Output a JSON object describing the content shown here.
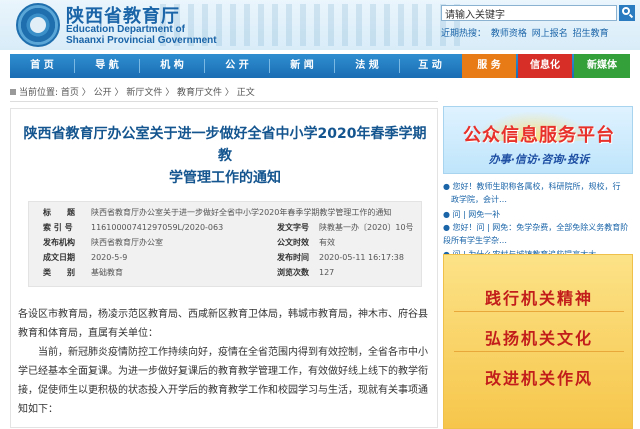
{
  "header": {
    "site_name": "陕西省教育厅",
    "site_en_line1": "Education Department of",
    "site_en_line2": "Shaanxi Provincial Government",
    "search": {
      "placeholder": "请输入关键字",
      "value": "请输入关键字"
    },
    "hot_search": [
      "近期热搜：",
      "教师资格",
      "网上报名",
      "招生教育"
    ],
    "search_icon": "search-icon",
    "emblem_icon": "emblem-logo"
  },
  "nav": {
    "items": [
      "首 页",
      "导 航",
      "机 构",
      "公 开",
      "新 闻",
      "法 规",
      "互 动",
      "服 务",
      "信息化",
      "新媒体"
    ]
  },
  "breadcrumb": "当前位置: 首页 〉 公开 〉 新厅文件 〉 教育厅文件 〉 正文",
  "article": {
    "title_line1": "陕西省教育厅办公室关于进一步做好全省中小学2020年春季学期教",
    "title_line2": "学管理工作的通知",
    "meta": {
      "title_k": "标　　题",
      "title_v": "陕西省教育厅办公室关于进一步做好全省中小学2020年春季学期教学管理工作的通知",
      "index_k": "索 引 号",
      "index_v": "11610000741297059L/2020-063",
      "docno_k": "发文字号",
      "docno_v": "陕教基一办〔2020〕10号",
      "org_k": "发布机构",
      "org_v": "陕西省教育厅办公室",
      "status_k": "公文时效",
      "status_v": "有效",
      "date_k": "成文日期",
      "date_v": "2020-5-9",
      "pub_k": "发布时间",
      "pub_v": "2020-05-11 16:17:38",
      "cat_k": "类　　别",
      "cat_v": "基础教育",
      "views_k": "浏览次数",
      "views_v": "127"
    },
    "body": [
      "各设区市教育局，杨凌示范区教育局、西咸新区教育卫体局，韩城市教育局，神木市、府谷县",
      "教育和体育局，直属有关单位：",
      "　　当前，新冠肺炎疫情防控工作持续向好，疫情在全省范围内得到有效控制，全省各市中小",
      "学已经基本全面复课。为进一步做好复课后的教育教学管理工作，有效做好线上线下的教学衔",
      "接，促使师生以更积极的状态投入开学后的教育教学工作和校园学习与生活，现就有关事项通",
      "知如下："
    ]
  },
  "sidebar": {
    "ad1_title": "公众信息服务平台",
    "ad1_sub": "办事·信访·咨询·投诉",
    "services": [
      "● 您好！教师生职称各属校，科研院所，规校，行",
      "　政学院，会计…",
      "● 问 | 网免一补",
      "● 您好！问 | 网免：免学杂费，全部免除义务教育阶段",
      "　所有学生学杂…",
      "● 问 | 为什么农村与城镇教育追些提高太大"
    ],
    "ad2_lines": [
      "践行机关精神",
      "弘扬机关文化",
      "改进机关作风"
    ]
  },
  "colors": {
    "nav_blue": "#1a6db3",
    "accent_orange": "#e87b16",
    "accent_red": "#d72f27",
    "accent_green": "#33a03a",
    "title_blue": "#14558f"
  }
}
